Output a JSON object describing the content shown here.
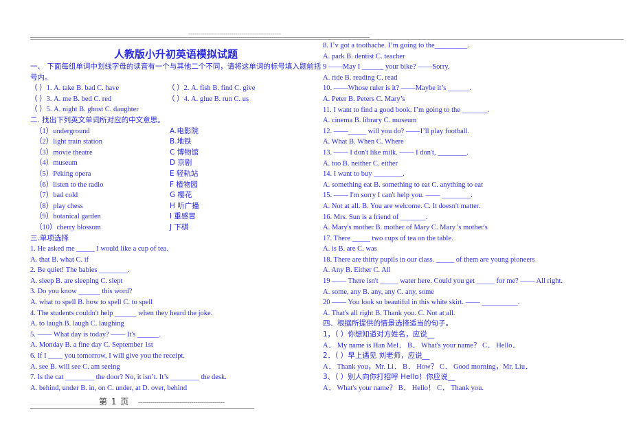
{
  "document": {
    "title": "人教版小升初英语模拟试题",
    "header_dash_light": "_________________________________________________",
    "header_dash_dark": "---------------------------------------------",
    "footer": {
      "dash_left": "______________________",
      "page_label": "第 1 页",
      "dash_right": "------------------------------------------"
    }
  },
  "left_column": {
    "section_one": {
      "instruction": "一、 下面每组单词中划线字母的读音有一个与其他二个不同，请将这单词的标号填入题前括号内。",
      "items": [
        {
          "left": "（ ）1. A. take B. bad C. have",
          "right": "（ ）2. A. fish B. find C. give"
        },
        {
          "left": "（ ）3. A. me B. bed C. red",
          "right": "（ ）4. A. glue B. run C. us"
        },
        {
          "left": "（ ）5. A. night B. ghost C. daughter",
          "right": ""
        }
      ]
    },
    "section_two": {
      "heading": "二. 找出下列英文单词所对应的中文意思。",
      "pairs": [
        {
          "eng": "（1）underground",
          "chn": "A.电影院"
        },
        {
          "eng": "（2）light train station",
          "chn": "B.地铁"
        },
        {
          "eng": "（3）movie theatre",
          "chn": "C 博物馆"
        },
        {
          "eng": "（4）museum",
          "chn": "D 京剧"
        },
        {
          "eng": "（5）Peking opera",
          "chn": "E 轻轨站"
        },
        {
          "eng": "（6）listen to the radio",
          "chn": "F 植物园"
        },
        {
          "eng": "（7）bad cold",
          "chn": "G 樱花"
        },
        {
          "eng": "（8）play chess",
          "chn": "H 听广播"
        },
        {
          "eng": "（9）botanical garden",
          "chn": "I 重感冒"
        },
        {
          "eng": "（10）cherry blossom",
          "chn": "J 下棋"
        }
      ]
    },
    "section_three": {
      "heading": "三.单项选择",
      "lines": [
        "1. He asked me _____ I would like a cup of tea.",
        "A. that B. what C. if",
        "2. Be quiet! The babies ________.",
        "A. sleep B. are sleeping C. slept",
        "3. Do you know ______ this word?",
        "A. what to spell B. how to spell C. to spell",
        "4. The students couldn't help ______ when they heard the joke.",
        "A. to laugh B. laugh C. laughing",
        "5. —— What day is today? —— It's ______.",
        "A. Monday B. a fine day C. September 1st",
        "6. If I ____ you tomorrow, I will give you the receipt.",
        "A. see B. will see C. am seeing",
        "7. Is the cat ________ the door? No, it isn’t. It’s ________ the desk.",
        "A. behind, under B. in, on C. under, at D. over, behind"
      ]
    }
  },
  "right_column": {
    "section_three_cont": {
      "lines": [
        "8. I’v got a toothache. I’m going to the_________.",
        "A. park B. dentist C. teacher",
        "9 ——May I ______ your bike? ——Sorry.",
        "A. ride B. reading C. read",
        "10. ——Whose ruler is it? ——Maybe it’s ______.",
        "A. Peter B. Peters C. Mary’s",
        "11. I want to find a good book. I’m going to the _______.",
        "A. cinema B. library C. museum",
        "12. ——_____ will you do? ——I’ll play football.",
        "A. What B. When C. Where",
        "13. —— I don't like milk. —— I don't, ________.",
        "A. too B. neither C. either",
        "14. I want to buy ________.",
        "A. something eat B. something to eat C. anything to eat",
        "15. —— I'm sorry I can't help you. —— ________.",
        "A. Not at all. B. You are welcome. C. It doesn't matter.",
        "16. Mrs. Sun is a friend of _______.",
        "A. Mary's mother B. mother of Mary C. Mary 's mother's",
        "17. There _____ two cups of tea on the table.",
        "A. is B. are C. was",
        "18. There are thirty pupils in our class. _____ of them are young pioneers",
        "A. Any B. Either C. All",
        "19 —— There isn't _____ water here. Could you get _____ for me? —— All right.",
        "A. some, any B. any, any C. any, some",
        "20 —— You look so beautiful in this white skirt. —— __________.",
        "A. That's all right B. Thank you. C. Not at all."
      ]
    },
    "section_four": {
      "heading": "四、根据所提供的情景选择适当的句子。",
      "items": [
        "1，（ ）你想知道对方姓名，应说__",
        "A． My name is Han Mel． B． What's your name？ C． Hello．",
        "2．（ ）早上遇见 刘老师，应说__",
        "A． Thank you，Mr. Li． B． How？ C． Good morning，Mr. Liu．",
        "3、（ ）别人向你打招呼 Hello！你应说__",
        "A． What's your name？ B． Hello！ C． Thank you."
      ]
    }
  }
}
